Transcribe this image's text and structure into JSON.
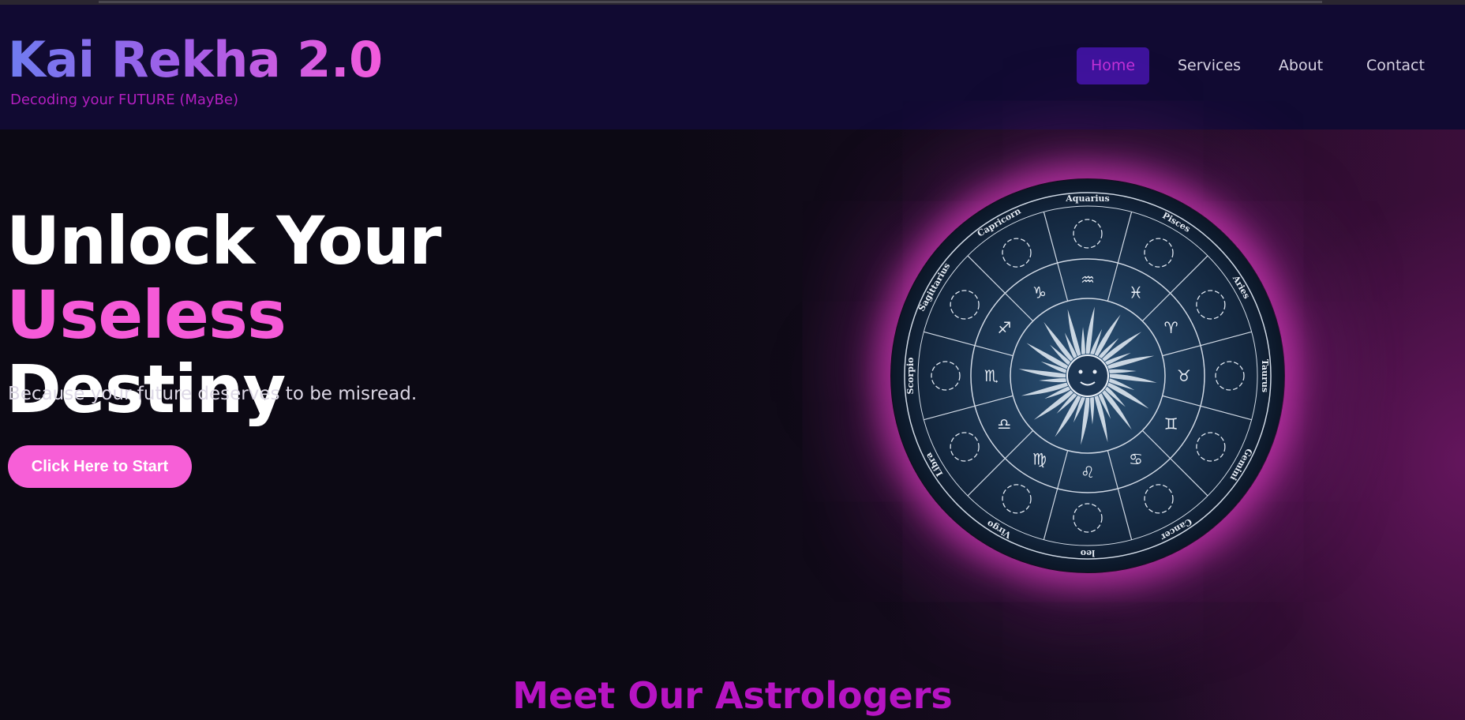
{
  "brand": {
    "title": "Kai Rekha 2.0",
    "tagline": "Decoding your FUTURE (MayBe)"
  },
  "nav": {
    "items": [
      {
        "label": "Home",
        "active": true
      },
      {
        "label": "Services",
        "active": false
      },
      {
        "label": "About",
        "active": false
      },
      {
        "label": "Contact",
        "active": false
      }
    ]
  },
  "hero": {
    "title_part1": "Unlock Your ",
    "title_accent": "Useless",
    "title_part2": "Destiny",
    "subtitle": "Because your future deserves to be misread.",
    "cta_label": "Click Here to Start"
  },
  "zodiac_wheel": {
    "signs": [
      "Aquarius",
      "Pisces",
      "Aries",
      "Taurus",
      "Gemini",
      "Cancer",
      "leo",
      "Virgo",
      "Libra",
      "Scorpio",
      "Sagittarius",
      "Capricorn"
    ],
    "symbols": [
      "♒",
      "♓",
      "♈",
      "♉",
      "♊",
      "♋",
      "♌",
      "♍",
      "♎",
      "♏",
      "♐",
      "♑"
    ]
  },
  "section": {
    "title": "Meet Our Astrologers"
  },
  "colors": {
    "accent_pink": "#f55ad8",
    "nav_active_bg": "#3e139c",
    "header_bg": "#110a32",
    "glow": "#e63cc8"
  }
}
